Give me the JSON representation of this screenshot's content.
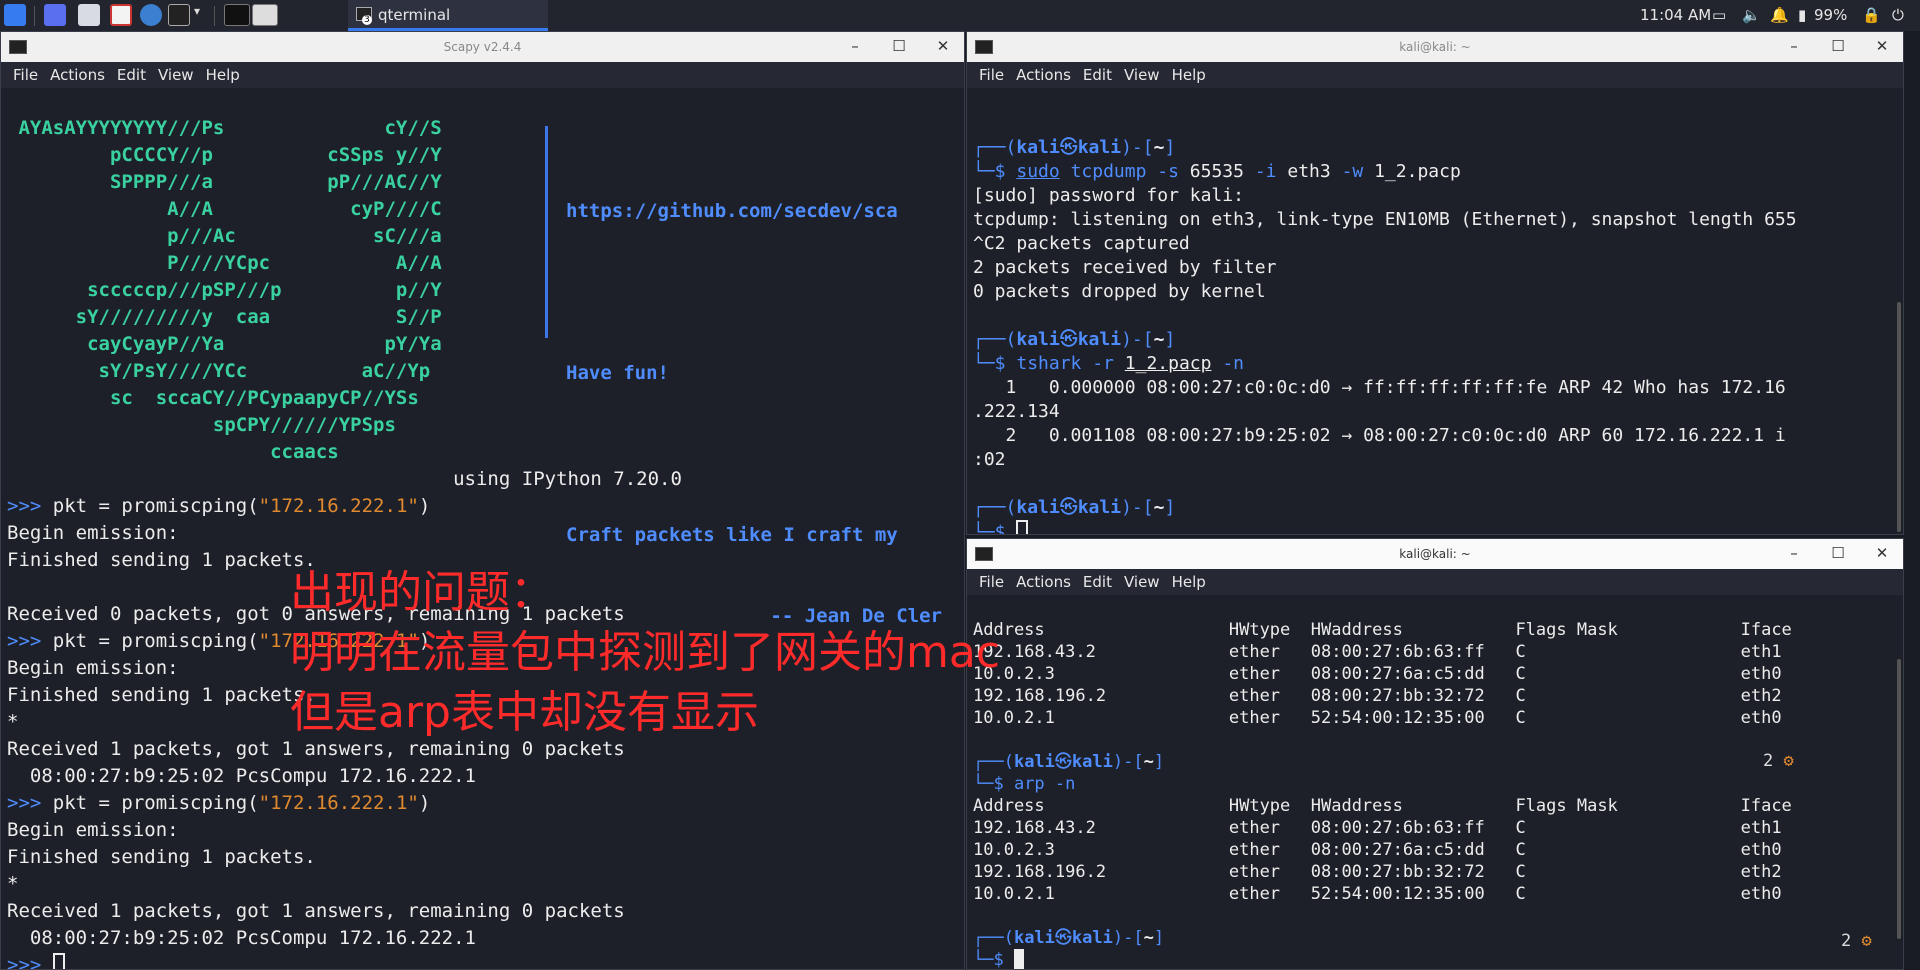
{
  "taskbar": {
    "task_label": "qterminal",
    "task_badge": "3",
    "clock": "11:04 AM",
    "battery": "99%"
  },
  "scapy": {
    "title": "Scapy v2.4.4",
    "menu": [
      "File",
      "Actions",
      "Edit",
      "View",
      "Help"
    ],
    "banner_art": [
      " AYAsAYYYYYYYY///Ps              cY//S",
      "         pCCCCY//p          cSSps y//Y",
      "         SPPPP///a          pP///AC//Y",
      "              A//A            cyP////C",
      "              p///Ac            sC///a",
      "              P////YCpc           A//A",
      "       scccccp///pSP///p          p//Y",
      "      sY/////////y  caa           S//P",
      "       cayCyayP//Ya              pY/Ya",
      "        sY/PsY////YCc          aC//Yp",
      "         sc  sccaCY//PCypaapyCP//YSs",
      "                  spCPY//////YPSps",
      "                       ccaacs"
    ],
    "banner_link": "https://github.com/secdev/sca",
    "banner_fun": "Have fun!",
    "banner_quote1": "Craft packets like I craft my",
    "banner_quote2": "-- Jean De Cler",
    "ipython": "                                       using IPython 7.20.0",
    "prompt": ">>>",
    "cmd_prefix": " pkt = promiscping(",
    "cmd_arg": "\"172.16.222.1\"",
    "cmd_suffix": ")",
    "begin": "Begin emission:",
    "finished": "Finished sending 1 packets.",
    "received0": "Received 0 packets, got 0 answers, remaining 1 packets",
    "star": "*",
    "received1": "Received 1 packets, got 1 answers, remaining 0 packets",
    "answer": "  08:00:27:b9:25:02 PcsCompu 172.16.222.1"
  },
  "kali_top": {
    "title": "kali@kali: ~",
    "menu": [
      "File",
      "Actions",
      "Edit",
      "View",
      "Help"
    ],
    "prompt_user": "kali",
    "prompt_skull": "㉿",
    "prompt_host": "kali",
    "prompt_dir": "~",
    "cmd1": [
      "sudo",
      "tcpdump",
      "-s",
      "65535",
      "-i",
      "eth3",
      "-w",
      "1_2.pacp"
    ],
    "out1": [
      "[sudo] password for kali:",
      "tcpdump: listening on eth3, link-type EN10MB (Ethernet), snapshot length 655",
      "^C2 packets captured",
      "2 packets received by filter",
      "0 packets dropped by kernel"
    ],
    "cmd2": [
      "tshark",
      "-r",
      "1_2.pacp",
      "-n"
    ],
    "out2": [
      "   1   0.000000 08:00:27:c0:0c:d0 → ff:ff:ff:ff:ff:fe ARP 42 Who has 172.16",
      ".222.134",
      "   2   0.001108 08:00:27:b9:25:02 → 08:00:27:c0:0c:d0 ARP 60 172.16.222.1 i",
      ":02"
    ]
  },
  "kali_bottom": {
    "title": "kali@kali: ~",
    "menu": [
      "File",
      "Actions",
      "Edit",
      "View",
      "Help"
    ],
    "arp_header": "Address                  HWtype  HWaddress           Flags Mask            Iface",
    "arp_rows_1": [
      "192.168.43.2             ether   08:00:27:6b:63:ff   C                     eth1",
      "10.0.2.3                 ether   08:00:27:6a:c5:dd   C                     eth0",
      "192.168.196.2            ether   08:00:27:bb:32:72   C                     eth2",
      "10.0.2.1                 ether   52:54:00:12:35:00   C                     eth0"
    ],
    "cmd": [
      "arp",
      "-n"
    ],
    "jobs": "2",
    "arp_rows_2": [
      "192.168.43.2             ether   08:00:27:6b:63:ff   C                     eth1",
      "10.0.2.3                 ether   08:00:27:6a:c5:dd   C                     eth0",
      "192.168.196.2            ether   08:00:27:bb:32:72   C                     eth2",
      "10.0.2.1                 ether   52:54:00:12:35:00   C                     eth0"
    ]
  },
  "annotation": {
    "line1": "出现的问题：",
    "line2": "明明在流量包中探测到了网关的mac",
    "line3": "但是arp表中却没有显示"
  },
  "colors": {
    "accent": "#367bf0",
    "cyan": "#3ad1a0",
    "blue": "#4f8dff",
    "annotation": "#ff2a2a"
  }
}
